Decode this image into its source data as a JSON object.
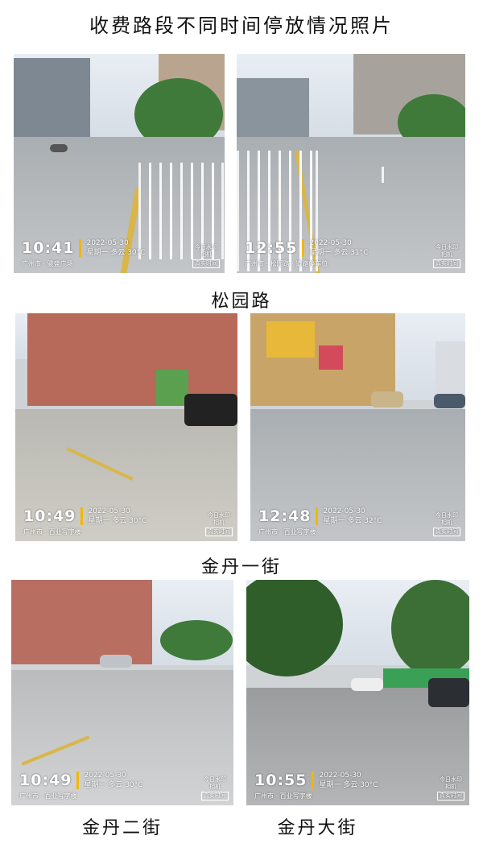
{
  "title": "收费路段不同时间停放情况照片",
  "captions": [
    "松园路",
    "金丹一街",
    "金丹二街",
    "金丹大街"
  ],
  "photos": [
    {
      "time": "10:41",
      "date": "2022-05-30",
      "weather": "星期一 多云 30°C",
      "place": "广州市 · 骏盛广场"
    },
    {
      "time": "12:55",
      "date": "2022-05-30",
      "weather": "星期一 多云 31°C",
      "place": "广州市 · 松园路 · 道路停车位"
    },
    {
      "time": "10:49",
      "date": "2022-05-30",
      "weather": "星期一 多云 30°C",
      "place": "广州市 · 百业写字楼"
    },
    {
      "time": "12:48",
      "date": "2022-05-30",
      "weather": "星期一 多云 32°C",
      "place": "广州市 · 百业写字楼"
    },
    {
      "time": "10:49",
      "date": "2022-05-30",
      "weather": "星期一 多云 30°C",
      "place": "广州市 · 百业写字楼"
    },
    {
      "time": "10:55",
      "date": "2022-05-30",
      "weather": "星期一 多云 30°C",
      "place": "广州市 · 百业写字楼"
    }
  ],
  "watermark": {
    "line1": "今日水印",
    "line2": "相机",
    "line3": "真实时间"
  }
}
